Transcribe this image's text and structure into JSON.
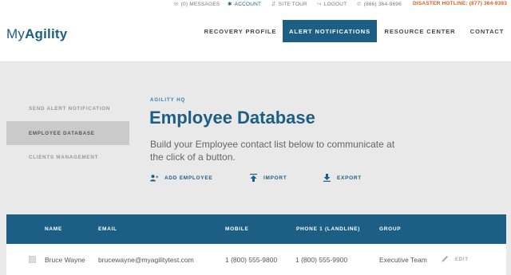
{
  "utility": {
    "messages": "(0) MESSAGES",
    "account": "ACCOUNT",
    "site_tour": "SITE TOUR",
    "logout": "LOGOUT",
    "phone": "(866) 364-9696",
    "hotline": "DISASTER HOTLINE: (877) 364-9393"
  },
  "logo": {
    "part1": "My",
    "part2": "Agility"
  },
  "nav": {
    "recovery_profile": "RECOVERY PROFILE",
    "alert_notifications": "ALERT NOTIFICATIONS",
    "resource_center": "RESOURCE CENTER",
    "contact": "CONTACT"
  },
  "sidebar": {
    "send_alert": "SEND ALERT NOTIFICATION",
    "employee_database": "EMPLOYEE DATABASE",
    "clients_management": "CLIENTS MANAGEMENT"
  },
  "main": {
    "eyebrow": "AGILITY HQ",
    "title": "Employee Database",
    "lead": "Build your Employee contact list below to communicate at the click of a button.",
    "actions": {
      "add_employee": "ADD EMPLOYEE",
      "import": "IMPORT",
      "export": "EXPORT"
    }
  },
  "table": {
    "headers": {
      "name": "NAME",
      "email": "EMAIL",
      "mobile": "MOBILE",
      "phone": "PHONE 1 (LANDLINE)",
      "group": "GROUP"
    },
    "rows": [
      {
        "name": "Bruce Wayne",
        "email": "brucewayne@myagilitytest.com",
        "mobile": "1 (800) 555-9800",
        "phone": "1 (800) 555-9900",
        "group": "Executive Team",
        "edit": "EDIT"
      }
    ]
  },
  "colors": {
    "brand": "#1d5f84",
    "hotline": "#e05a1c",
    "accent": "#2a7fae"
  }
}
